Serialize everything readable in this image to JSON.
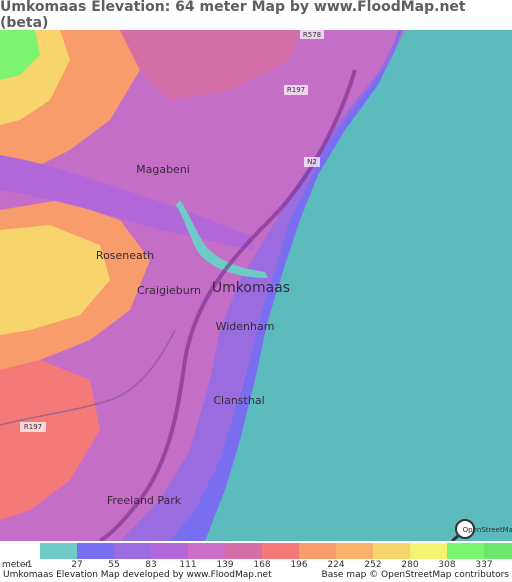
{
  "title": "Umkomaas Elevation: 64 meter Map by www.FloodMap.net (beta)",
  "map": {
    "places": [
      {
        "name": "Magabeni"
      },
      {
        "name": "Roseneath"
      },
      {
        "name": "Craigieburn"
      },
      {
        "name": "Umkomaas"
      },
      {
        "name": "Widenham"
      },
      {
        "name": "Clansthal"
      },
      {
        "name": "Freeland Park"
      }
    ],
    "roads": [
      "R578",
      "R197",
      "N2",
      "R197"
    ],
    "logo_text": "OpenStreetMap"
  },
  "legend": {
    "unit": "meter",
    "labels": [
      "-1",
      "27",
      "55",
      "83",
      "111",
      "139",
      "168",
      "196",
      "224",
      "252",
      "280",
      "308",
      "337"
    ],
    "colors": [
      "#6fcbc5",
      "#7a6ef0",
      "#9b6ce0",
      "#b368d9",
      "#cc6ec8",
      "#d46ea6",
      "#f47a7a",
      "#f89c6c",
      "#f8b26c",
      "#f8d46c",
      "#f4f472",
      "#7cf472",
      "#6ee66e"
    ]
  },
  "footer": {
    "left": "Umkomaas Elevation Map developed by www.FloodMap.net",
    "right": "Base map © OpenStreetMap contributors"
  }
}
